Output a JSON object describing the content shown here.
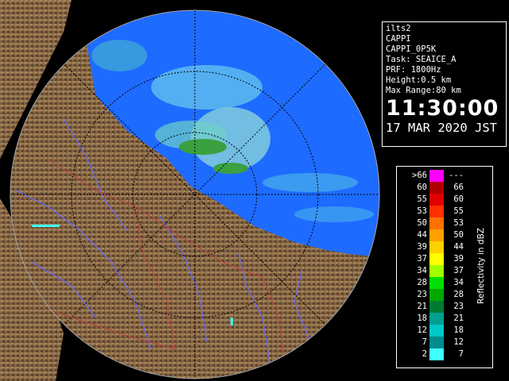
{
  "info": {
    "station": "ilts2",
    "product": "CAPPI",
    "product_name": "CAPPI_0P5K",
    "task": "Task: SEAICE_A",
    "prf": "PRF: 1800Hz",
    "height": "Height:0.5 km",
    "max_range": "Max Range:80 km",
    "time": "11:30:00",
    "date": "17 MAR 2020 JST"
  },
  "legend": {
    "unit_label": "Reflectivity in dBZ",
    "rows": [
      {
        "low": ">66",
        "high": "---",
        "color": "#ff00ff"
      },
      {
        "low": "60",
        "high": "66",
        "color": "#b00000"
      },
      {
        "low": "55",
        "high": "60",
        "color": "#e00000"
      },
      {
        "low": "53",
        "high": "55",
        "color": "#ff3000"
      },
      {
        "low": "50",
        "high": "53",
        "color": "#ff7000"
      },
      {
        "low": "44",
        "high": "50",
        "color": "#ffa000"
      },
      {
        "low": "39",
        "high": "44",
        "color": "#ffd000"
      },
      {
        "low": "37",
        "high": "39",
        "color": "#ffff00"
      },
      {
        "low": "34",
        "high": "37",
        "color": "#a0ff00"
      },
      {
        "low": "28",
        "high": "34",
        "color": "#00e000"
      },
      {
        "low": "23",
        "high": "28",
        "color": "#00a800"
      },
      {
        "low": "21",
        "high": "23",
        "color": "#007a30"
      },
      {
        "low": "18",
        "high": "21",
        "color": "#00a090"
      },
      {
        "low": "12",
        "high": "18",
        "color": "#00c8c8"
      },
      {
        "low": "7",
        "high": "12",
        "color": "#008c8c"
      },
      {
        "low": "2",
        "high": "7",
        "color": "#40ffff"
      }
    ]
  },
  "map": {
    "land_color": "#8a6a44",
    "sea_color": "#1a5cff",
    "radar_sea_color": "#1e6bff",
    "echo_light_color": "#7fe8e8",
    "echo_green_color": "#3aa040",
    "river_color": "#6a6aff",
    "border_color": "#c04040",
    "range_ring_color": "#000000"
  }
}
